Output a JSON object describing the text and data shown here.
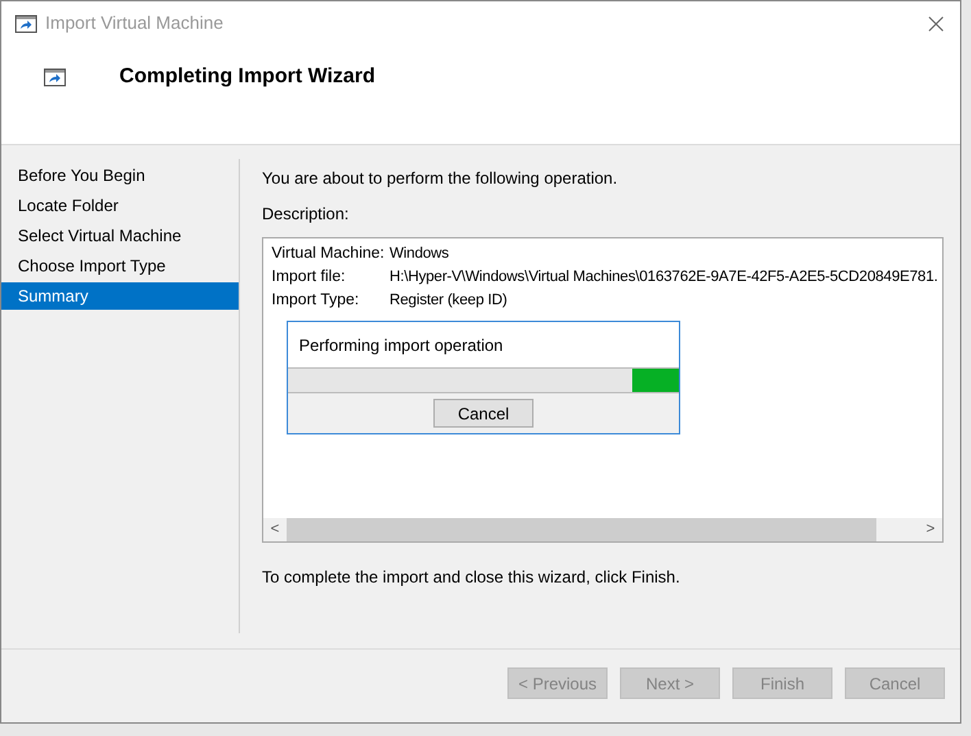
{
  "window": {
    "title": "Import Virtual Machine"
  },
  "header": {
    "title": "Completing Import Wizard"
  },
  "sidebar": {
    "items": [
      {
        "label": "Before You Begin",
        "selected": false
      },
      {
        "label": "Locate Folder",
        "selected": false
      },
      {
        "label": "Select Virtual Machine",
        "selected": false
      },
      {
        "label": "Choose Import Type",
        "selected": false
      },
      {
        "label": "Summary",
        "selected": true
      }
    ]
  },
  "intro": "You are about to perform the following operation.",
  "description": {
    "label": "Description:",
    "rows": [
      {
        "label": "Virtual Machine:",
        "value": "Windows"
      },
      {
        "label": "Import file:",
        "value": "H:\\Hyper-V\\Windows\\Virtual Machines\\0163762E-9A7E-42F5-A2E5-5CD20849E781."
      },
      {
        "label": "Import Type:",
        "value": "Register (keep ID)"
      }
    ],
    "scroll_left": "<",
    "scroll_right": ">"
  },
  "progress_dialog": {
    "title": "Performing import operation",
    "level": 0.12,
    "cancel": "Cancel"
  },
  "footer_text": "To complete the import and close this wizard, click Finish.",
  "buttons": [
    {
      "label": "< Previous",
      "disabled": true
    },
    {
      "label": "Next >",
      "disabled": true
    },
    {
      "label": "Finish",
      "disabled": true
    },
    {
      "label": "Cancel",
      "disabled": true
    }
  ]
}
